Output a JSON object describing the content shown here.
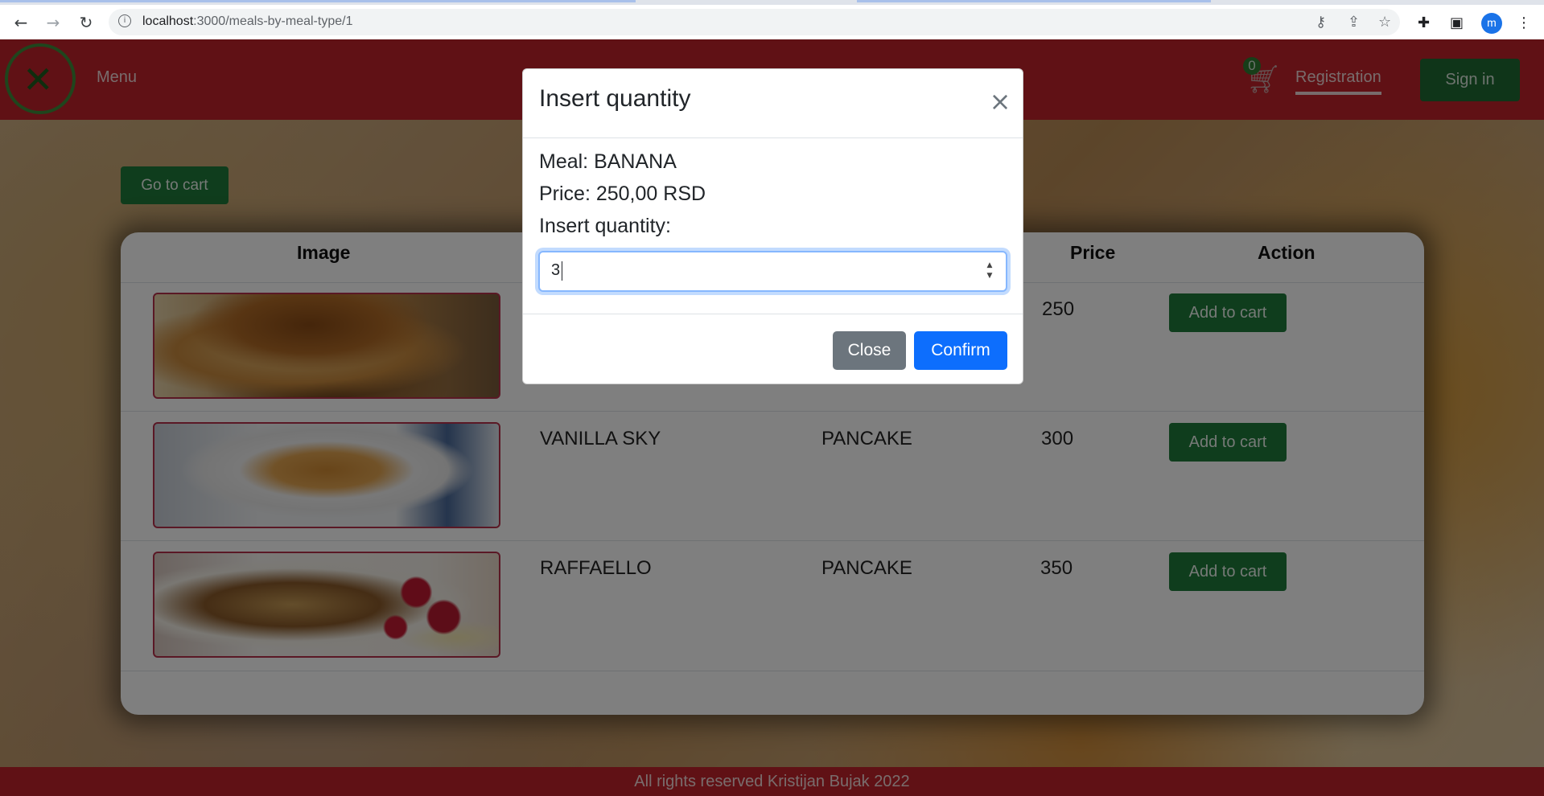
{
  "browser": {
    "url_host": "localhost",
    "url_path": ":3000/meals-by-meal-type/1",
    "profile_initial": "m",
    "icons": {
      "back": "arrow-left-icon",
      "forward": "arrow-right-icon",
      "reload": "reload-icon",
      "site_info": "info-icon",
      "password_key": "key-icon",
      "share": "share-icon",
      "bookmark": "star-icon",
      "extensions": "puzzle-icon",
      "side_panel": "side-panel-icon",
      "more": "kebab-menu-icon"
    }
  },
  "navbar": {
    "menu_label": "Menu",
    "cart_count": "0",
    "registration_label": "Registration",
    "signin_label": "Sign in",
    "brand_color": "#c0232a"
  },
  "page": {
    "goto_cart_label": "Go to cart"
  },
  "table": {
    "headers": {
      "image": "Image",
      "price": "Price",
      "action": "Action"
    },
    "rows": [
      {
        "name": "",
        "type": "",
        "price": "250",
        "action_label": "Add to cart",
        "image": "pancake-stack-with-syrup"
      },
      {
        "name": "VANILLA SKY",
        "type": "PANCAKE",
        "price": "300",
        "action_label": "Add to cart",
        "image": "pancakes-on-plate"
      },
      {
        "name": "RAFFAELLO",
        "type": "PANCAKE",
        "price": "350",
        "action_label": "Add to cart",
        "image": "crepes-with-raspberries"
      }
    ]
  },
  "footer": {
    "text": "All rights reserved Kristijan Bujak 2022"
  },
  "modal": {
    "title": "Insert quantity",
    "meal_line": "Meal: BANANA",
    "price_line": "Price: 250,00 RSD",
    "quantity_label": "Insert quantity:",
    "quantity_value": "3",
    "close_label": "Close",
    "confirm_label": "Confirm",
    "close_icon": "×"
  }
}
